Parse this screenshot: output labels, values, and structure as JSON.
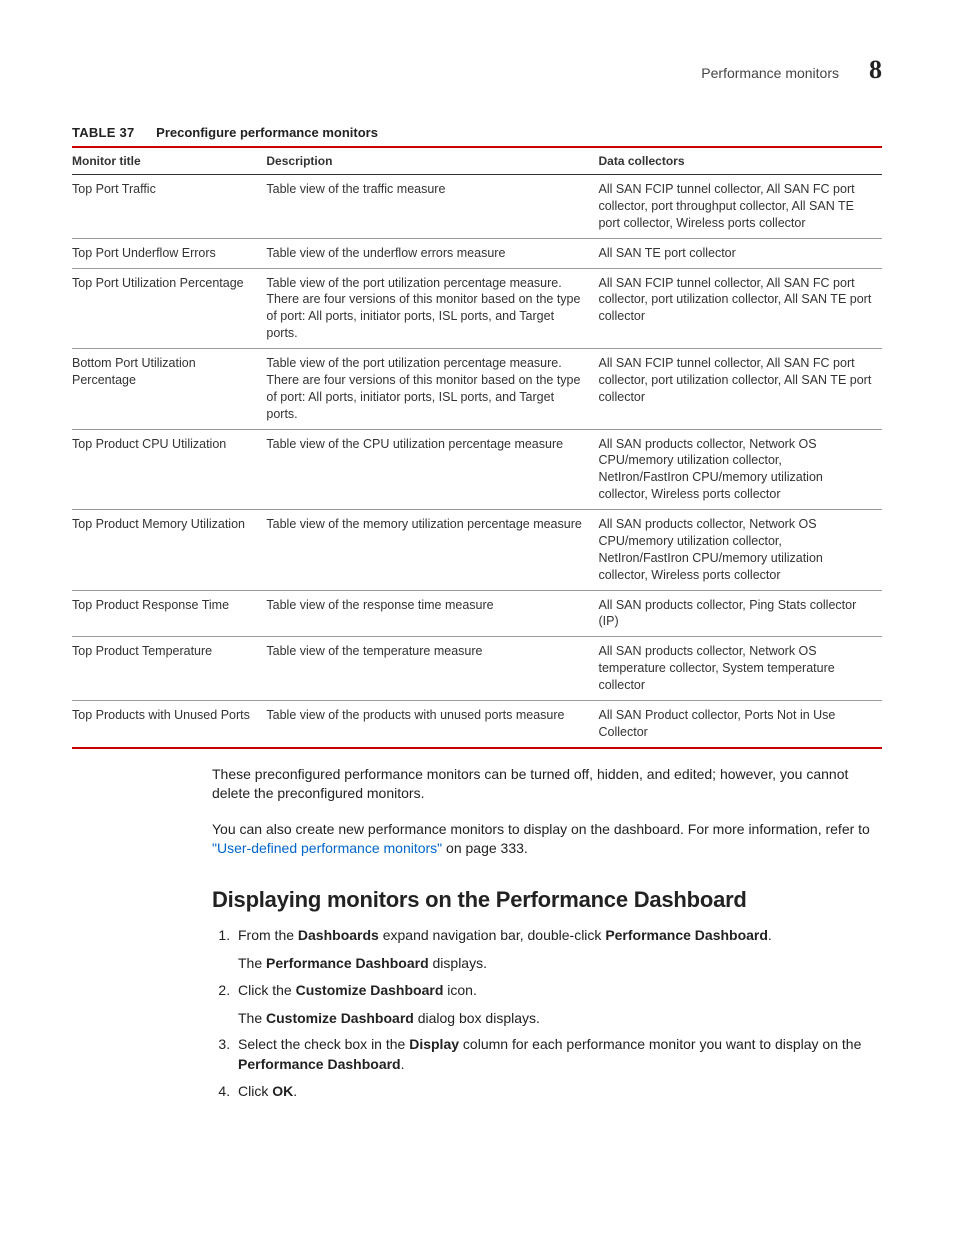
{
  "header": {
    "section": "Performance monitors",
    "chapter": "8"
  },
  "table": {
    "label": "TABLE 37",
    "title": "Preconfigure performance monitors",
    "headers": {
      "col1": "Monitor title",
      "col2": "Description",
      "col3": "Data collectors"
    },
    "rows": [
      {
        "title": "Top Port Traffic",
        "desc": "Table view of the traffic measure",
        "collectors": "All SAN FCIP tunnel collector, All SAN FC port collector, port throughput collector, All SAN TE port collector, Wireless ports collector"
      },
      {
        "title": "Top Port Underflow Errors",
        "desc": "Table view of the underflow errors measure",
        "collectors": "All SAN TE port collector"
      },
      {
        "title": "Top Port Utilization Percentage",
        "desc": "Table view of the port utilization percentage measure. There are four versions of this monitor based on the type of port: All ports, initiator ports, ISL ports, and Target ports.",
        "collectors": "All SAN FCIP tunnel collector, All SAN FC port collector, port utilization collector, All SAN TE port collector"
      },
      {
        "title": "Bottom Port Utilization Percentage",
        "desc": "Table view of the port utilization percentage measure. There are four versions of this monitor based on the type of port: All ports, initiator ports, ISL ports, and Target ports.",
        "collectors": "All SAN FCIP tunnel collector, All SAN FC port collector, port utilization collector, All SAN TE port collector"
      },
      {
        "title": "Top Product CPU Utilization",
        "desc": "Table view of the CPU utilization percentage measure",
        "collectors": "All SAN products collector, Network OS CPU/memory utilization collector, NetIron/FastIron CPU/memory utilization collector, Wireless ports collector"
      },
      {
        "title": "Top Product Memory Utilization",
        "desc": "Table view of the memory utilization percentage measure",
        "collectors": "All SAN products collector, Network OS CPU/memory utilization collector, NetIron/FastIron CPU/memory utilization collector, Wireless ports collector"
      },
      {
        "title": "Top Product Response Time",
        "desc": "Table view of the response time measure",
        "collectors": "All SAN products collector, Ping Stats collector (IP)"
      },
      {
        "title": "Top Product Temperature",
        "desc": "Table view of the temperature measure",
        "collectors": "All SAN products collector, Network OS temperature collector, System temperature collector"
      },
      {
        "title": "Top Products with Unused Ports",
        "desc": "Table view of the products with unused ports measure",
        "collectors": "All SAN Product collector, Ports Not in Use Collector"
      }
    ]
  },
  "paragraphs": {
    "p1": "These preconfigured performance monitors can be turned off, hidden, and edited; however, you cannot delete the preconfigured monitors.",
    "p2_pre": "You can also create new performance monitors to display on the dashboard. For more information, refer to ",
    "p2_link": "\"User-defined performance monitors\"",
    "p2_post": " on page 333."
  },
  "section_heading": "Displaying monitors on the Performance Dashboard",
  "steps": {
    "s1_pre": "From the ",
    "s1_b1": "Dashboards",
    "s1_mid": " expand navigation bar, double-click ",
    "s1_b2": "Performance Dashboard",
    "s1_post": ".",
    "s1_sub_pre": "The ",
    "s1_sub_b": "Performance Dashboard",
    "s1_sub_post": " displays.",
    "s2_pre": "Click the ",
    "s2_b": "Customize Dashboard",
    "s2_post": " icon.",
    "s2_sub_pre": "The ",
    "s2_sub_b": "Customize Dashboard",
    "s2_sub_post": " dialog box displays.",
    "s3_pre": "Select the check box in the ",
    "s3_b1": "Display",
    "s3_mid": " column for each performance monitor you want to display on the ",
    "s3_b2": "Performance Dashboard",
    "s3_post": ".",
    "s4_pre": "Click ",
    "s4_b": "OK",
    "s4_post": "."
  }
}
